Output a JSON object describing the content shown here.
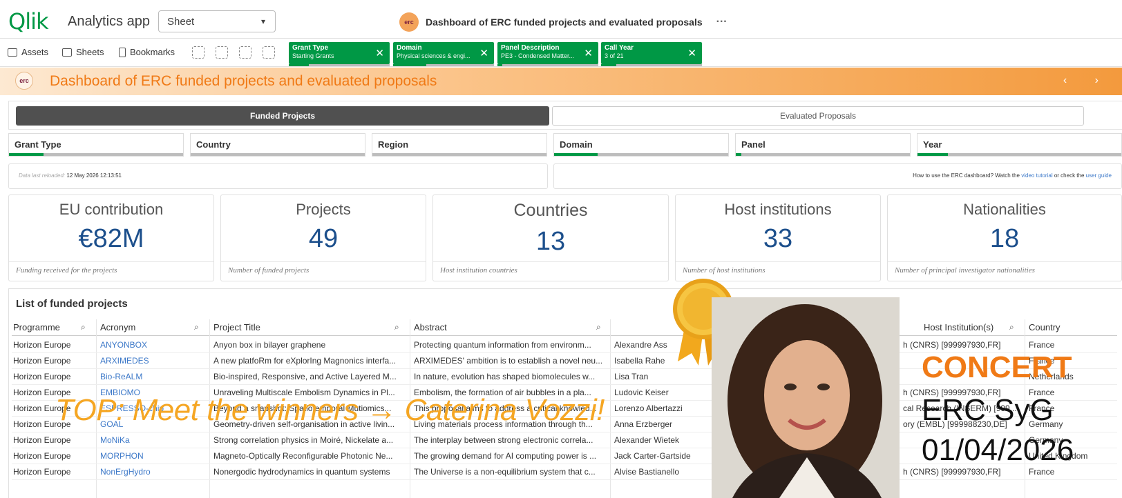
{
  "header": {
    "logo": "Qlik",
    "app_name": "Analytics app",
    "sheet_select": "Sheet",
    "erc_logo_text": "erc",
    "title": "Dashboard of ERC funded projects and evaluated proposals",
    "more": "···"
  },
  "toolbar": {
    "assets": "Assets",
    "sheets": "Sheets",
    "bookmarks": "Bookmarks",
    "selections": [
      {
        "title": "Grant Type",
        "value": "Starting Grants",
        "fill": 0.2
      },
      {
        "title": "Domain",
        "value": "Physical sciences & engi...",
        "fill": 0.33
      },
      {
        "title": "Panel Description",
        "value": "PE3 - Condensed Matter...",
        "fill": 0.05
      },
      {
        "title": "Call Year",
        "value": "3 of 21",
        "fill": 0.15
      }
    ]
  },
  "banner": {
    "title": "Dashboard of ERC funded projects and evaluated proposals",
    "nav": "‹ ›"
  },
  "tabs": {
    "funded": "Funded Projects",
    "evaluated": "Evaluated Proposals"
  },
  "filters": [
    {
      "label": "Grant Type",
      "fill": 0.2
    },
    {
      "label": "Country",
      "fill": 0.0
    },
    {
      "label": "Region",
      "fill": 0.0
    },
    {
      "label": "Domain",
      "fill": 0.25
    },
    {
      "label": "Panel",
      "fill": 0.03
    },
    {
      "label": "Year",
      "fill": 0.15
    }
  ],
  "info": {
    "reload_label": "Data last reloaded:",
    "reload_value": "12 May 2026 12:13:51",
    "howto_text": "How to use the ERC dashboard? Watch the",
    "video_link": "video tutorial",
    "or_text": "or check the",
    "guide_link": "user guide"
  },
  "kpis": [
    {
      "title": "EU contribution",
      "value": "€82M",
      "footer": "Funding received for the projects"
    },
    {
      "title": "Projects",
      "value": "49",
      "footer": "Number of funded projects"
    },
    {
      "title": "Countries",
      "value": "13",
      "footer": "Host institution countries"
    },
    {
      "title": "Host institutions",
      "value": "33",
      "footer": "Number of host institutions"
    },
    {
      "title": "Nationalities",
      "value": "18",
      "footer": "Number of principal investigator nationalities"
    }
  ],
  "table": {
    "title": "List of funded projects",
    "columns": [
      "Programme",
      "Acronym",
      "Project Title",
      "Abstract",
      "Host Institution(s)",
      "Country"
    ],
    "rows": [
      [
        "Horizon Europe",
        "ANYONBOX",
        "Anyon box in bilayer graphene",
        "Protecting quantum information from environm...",
        "Alexandre Ass",
        "h (CNRS) [999997930,FR]",
        "France"
      ],
      [
        "Horizon Europe",
        "ARXIMEDES",
        "A new platfoRm for eXplorIng Magnonics interfa...",
        "ARXIMEDES' ambition is to establish a novel neu...",
        "Isabella Rahe",
        "",
        "France"
      ],
      [
        "Horizon Europe",
        "Bio-ReALM",
        "Bio-inspired, Responsive, and Active Layered M...",
        "In nature, evolution has shaped biomolecules w...",
        "Lisa Tran",
        "",
        "Netherlands"
      ],
      [
        "Horizon Europe",
        "EMBIOMO",
        "Unraveling Multiscale Embolism Dynamics in Pl...",
        "Embolism, the formation of air bubbles in a pla...",
        "Ludovic Keiser",
        "h (CNRS) [999997930,FR]",
        "France"
      ],
      [
        "Horizon Europe",
        "ESPRESSO-chip",
        "Beyond a snapshot: Spatiotemporal Mutiomics...",
        "This proposal aims to address a critical knowled...",
        "Lorenzo Albertazzi",
        "cal Research (INSERM) [999...",
        "France"
      ],
      [
        "Horizon Europe",
        "GOAL",
        "Geometry-driven self-organisation in active livin...",
        "Living materials process information through th...",
        "Anna Erzberger",
        "ory (EMBL) [999988230,DE]",
        "Germany"
      ],
      [
        "Horizon Europe",
        "MoNiKa",
        "Strong correlation physics in Moiré, Nickelate a...",
        "The interplay between strong electronic correla...",
        "Alexander Wietek",
        "",
        "Germany"
      ],
      [
        "Horizon Europe",
        "MORPHON",
        "Magneto-Optically Reconfigurable Photonic Ne...",
        "The growing demand for AI computing power is ...",
        "Jack Carter-Gartside",
        "",
        "United Kingdom"
      ],
      [
        "Horizon Europe",
        "NonErgHydro",
        "Nonergodic hydrodynamics in quantum systems",
        "The Universe is a non-equilibrium system that c...",
        "Alvise Bastianello",
        "h (CNRS) [999997930,FR]",
        "France"
      ]
    ]
  },
  "overlay": {
    "promo": "TOP: Meet the winners → Caterina Vozzi!",
    "concert": "CONCERT",
    "erc_syg": "ERC SyG",
    "date": "01/04/2026"
  },
  "colors": {
    "accent": "#009845",
    "banner": "#f39a3d",
    "kpi_value": "#1c4f8c",
    "promo": "#f5a623"
  }
}
